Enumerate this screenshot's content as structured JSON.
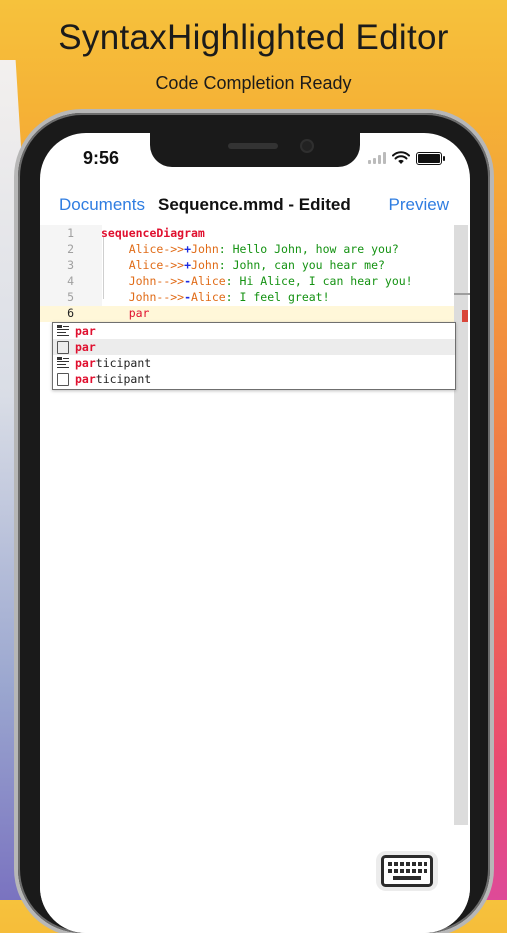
{
  "headline": {
    "title": "SyntaxHighlighted Editor",
    "subtitle": "Code Completion Ready"
  },
  "status_bar": {
    "time": "9:56"
  },
  "navbar": {
    "left": "Documents",
    "title": "Sequence.mmd - Edited",
    "right": "Preview"
  },
  "editor": {
    "line_numbers": [
      "1",
      "2",
      "3",
      "4",
      "5",
      "6"
    ],
    "lines": [
      {
        "indent": "",
        "parts": [
          {
            "t": "sequenceDiagram",
            "c": "kw"
          }
        ]
      },
      {
        "indent": "    ",
        "parts": [
          {
            "t": "Alice",
            "c": "actor"
          },
          {
            "t": "->>",
            "c": "arrow"
          },
          {
            "t": "+",
            "c": "plus"
          },
          {
            "t": "John",
            "c": "actor"
          },
          {
            "t": ": Hello John, how are you?",
            "c": "msg"
          }
        ]
      },
      {
        "indent": "    ",
        "parts": [
          {
            "t": "Alice",
            "c": "actor"
          },
          {
            "t": "->>",
            "c": "arrow"
          },
          {
            "t": "+",
            "c": "plus"
          },
          {
            "t": "John",
            "c": "actor"
          },
          {
            "t": ": John, can you hear me?",
            "c": "msg"
          }
        ]
      },
      {
        "indent": "    ",
        "parts": [
          {
            "t": "John",
            "c": "actor"
          },
          {
            "t": "-->>",
            "c": "arrow"
          },
          {
            "t": "-",
            "c": "plus"
          },
          {
            "t": "Alice",
            "c": "actor"
          },
          {
            "t": ": Hi Alice, I can hear you!",
            "c": "msg"
          }
        ]
      },
      {
        "indent": "    ",
        "parts": [
          {
            "t": "John",
            "c": "actor"
          },
          {
            "t": "-->>",
            "c": "arrow"
          },
          {
            "t": "-",
            "c": "plus"
          },
          {
            "t": "Alice",
            "c": "actor"
          },
          {
            "t": ": I feel great!",
            "c": "msg"
          }
        ]
      },
      {
        "indent": "    ",
        "parts": [
          {
            "t": "par",
            "c": "cursorword"
          }
        ]
      }
    ]
  },
  "autocomplete": {
    "items": [
      {
        "icon": "snippet-icon",
        "match": "par",
        "rest": ""
      },
      {
        "icon": "keyword-box-icon",
        "match": "par",
        "rest": ""
      },
      {
        "icon": "snippet-icon",
        "match": "par",
        "rest": "ticipant"
      },
      {
        "icon": "keyword-box-icon",
        "match": "par",
        "rest": "ticipant"
      }
    ],
    "selected_index": 1
  },
  "colors": {
    "accent_blue": "#2f7de1",
    "keyword_red": "#e0102f",
    "actor_orange": "#e06b17",
    "message_green": "#149212",
    "operator_blue": "#1d2be0"
  },
  "icons": {
    "keyboard": "keyboard-icon"
  }
}
